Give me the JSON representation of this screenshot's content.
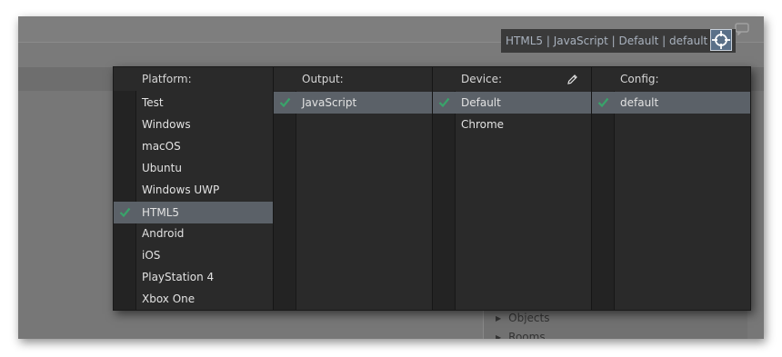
{
  "toolbar": {
    "target_summary": "HTML5 | JavaScript | Default | default"
  },
  "resource_tree": {
    "items": [
      "Objects",
      "Rooms"
    ]
  },
  "columns": {
    "platform": {
      "header": "Platform:",
      "items": [
        "Test",
        "Windows",
        "macOS",
        "Ubuntu",
        "Windows UWP",
        "HTML5",
        "Android",
        "iOS",
        "PlayStation 4",
        "Xbox One"
      ],
      "selected": "HTML5"
    },
    "output": {
      "header": "Output:",
      "items": [
        "JavaScript"
      ],
      "selected": "JavaScript"
    },
    "device": {
      "header": "Device:",
      "items": [
        "Default",
        "Chrome"
      ],
      "selected": "Default"
    },
    "config": {
      "header": "Config:",
      "items": [
        "default"
      ],
      "selected": "default"
    }
  },
  "colors": {
    "accent_check": "#39a36a",
    "selected_row": "#5b6168",
    "target_button": "#5a7088"
  },
  "icons": {
    "check": "check-icon",
    "edit": "pencil-icon",
    "target": "crosshair-icon",
    "chat": "chat-icon"
  }
}
